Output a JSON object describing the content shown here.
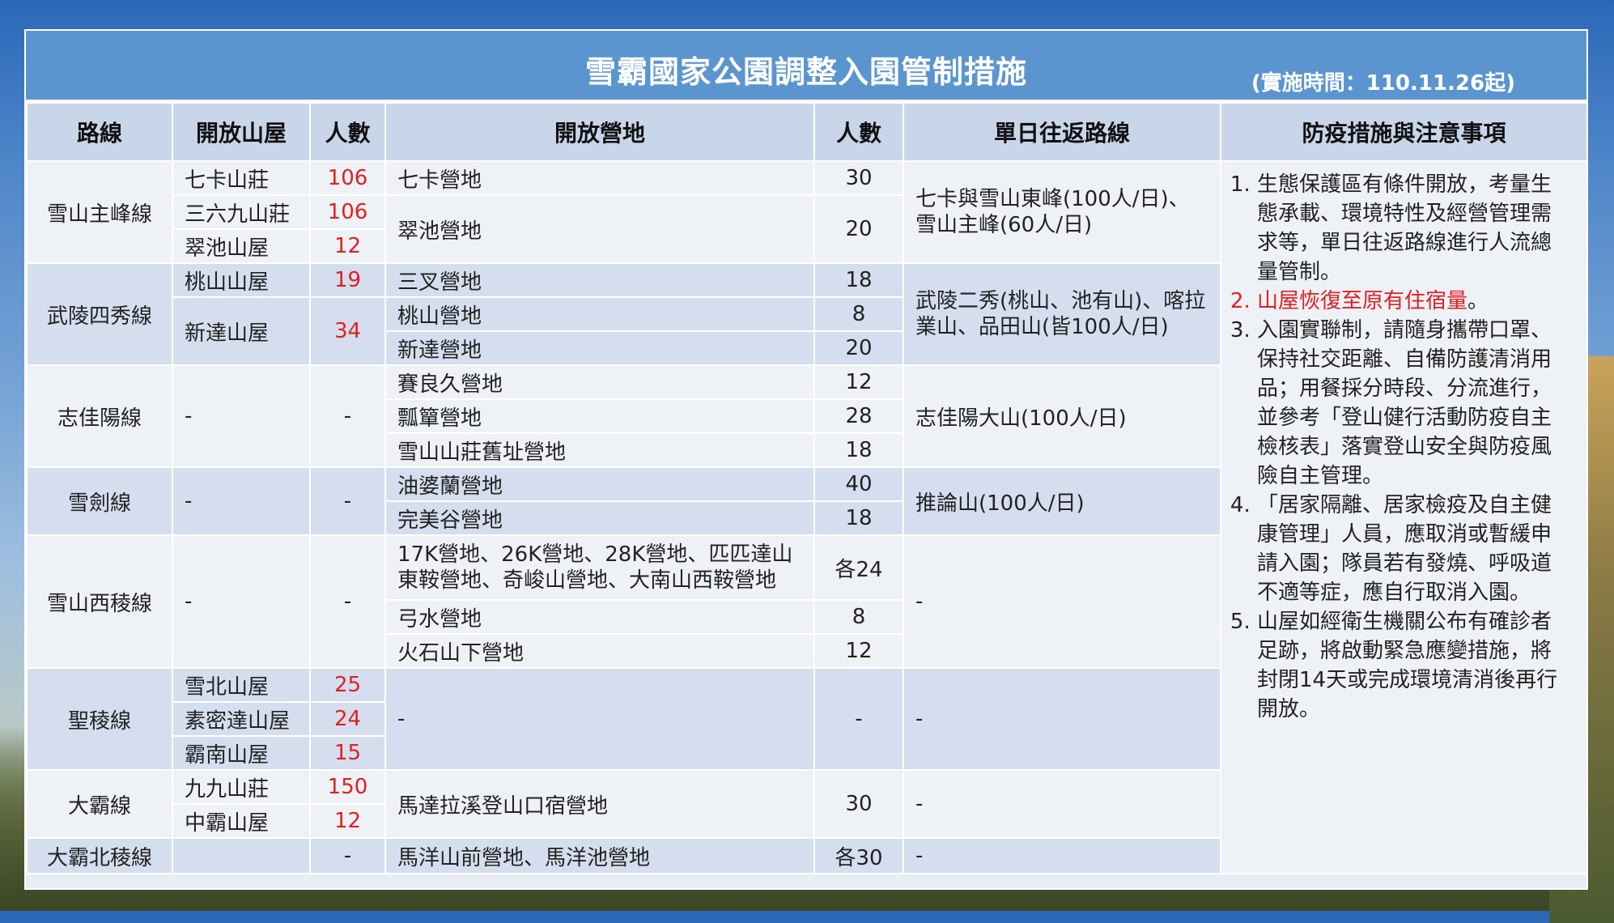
{
  "title": "雪霸國家公園調整入園管制措施",
  "effective_date": "(實施時間：110.11.26起)",
  "headers": {
    "route": "路線",
    "hut": "開放山屋",
    "hut_count": "人數",
    "camp": "開放營地",
    "camp_count": "人數",
    "day_route": "單日往返路線",
    "notes": "防疫措施與注意事項"
  },
  "rows": [
    {
      "route": "雪山主峰線",
      "hut": "七卡山莊",
      "hut_count": "106",
      "camp": "七卡營地",
      "camp_count": "30",
      "day_route": "七卡與雪山東峰(100人/日)、雪山主峰(60人/日)"
    },
    {
      "hut": "三六九山莊",
      "hut_count": "106",
      "camp": "翠池營地",
      "camp_count": "20"
    },
    {
      "hut": "翠池山屋",
      "hut_count": "12"
    },
    {
      "route": "武陵四秀線",
      "hut": "桃山山屋",
      "hut_count": "19",
      "camp": "三叉營地",
      "camp_count": "18",
      "day_route": "武陵二秀(桃山、池有山)、喀拉業山、品田山(皆100人/日)"
    },
    {
      "camp": "桃山營地",
      "camp_count": "8"
    },
    {
      "hut": "新達山屋",
      "hut_count": "34",
      "camp": "新達營地",
      "camp_count": "20"
    },
    {
      "route": "志佳陽線",
      "hut": "-",
      "hut_count": "-",
      "camp": "賽良久營地",
      "camp_count": "12",
      "day_route": "志佳陽大山(100人/日)"
    },
    {
      "camp": "瓢簞營地",
      "camp_count": "28"
    },
    {
      "camp": "雪山山莊舊址營地",
      "camp_count": "18"
    },
    {
      "route": "雪劍線",
      "hut": "-",
      "hut_count": "-",
      "camp": "油婆蘭營地",
      "camp_count": "40",
      "day_route": "推論山(100人/日)"
    },
    {
      "camp": "完美谷營地",
      "camp_count": "18"
    },
    {
      "route": "雪山西稜線",
      "hut": "-",
      "hut_count": "-",
      "camp": "17K營地、26K營地、28K營地、匹匹達山東鞍營地、奇峻山營地、大南山西鞍營地",
      "camp_count": "各24",
      "day_route": "-"
    },
    {
      "camp": "弓水營地",
      "camp_count": "8"
    },
    {
      "camp": "火石山下營地",
      "camp_count": "12"
    },
    {
      "route": "聖稜線",
      "hut": "雪北山屋",
      "hut_count": "25",
      "camp": "-",
      "camp_count": "-",
      "day_route": "-"
    },
    {
      "hut": "素密達山屋",
      "hut_count": "24"
    },
    {
      "hut": "霸南山屋",
      "hut_count": "15"
    },
    {
      "route": "大霸線",
      "hut": "九九山莊",
      "hut_count": "150",
      "camp": "馬達拉溪登山口宿營地",
      "camp_count": "30",
      "day_route": "-"
    },
    {
      "hut": "中霸山屋",
      "hut_count": "12"
    },
    {
      "route": "大霸北稜線",
      "hut": "",
      "hut_count": "-",
      "camp": "馬洋山前營地、馬洋池營地",
      "camp_count": "各30",
      "day_route": "-"
    }
  ],
  "notes": [
    "生態保護區有條件開放，考量生態承載、環境特性及經營管理需求等，單日往返路線進行人流總量管制。",
    "山屋恢復至原有住宿量",
    "入園實聯制，請隨身攜帶口罩、保持社交距離、自備防護清消用品；用餐採分時段、分流進行，並參考「登山健行活動防疫自主檢核表」落實登山安全與防疫風險自主管理。",
    "「居家隔離、居家檢疫及自主健康管理」人員，應取消或暫緩申請入園；隊員若有發燒、呼吸道不適等症，應自行取消入園。",
    "山屋如經衛生機關公布有確診者足跡，將啟動緊急應變措施，將封閉14天或完成環境清消後再行開放。"
  ],
  "note2_tail": "。",
  "colors": {
    "title_bar": "#5b95cf",
    "header": "#c9d6ea",
    "group_light": "#eef1f6",
    "group_dark": "#d4deee",
    "highlight": "#e02020"
  }
}
